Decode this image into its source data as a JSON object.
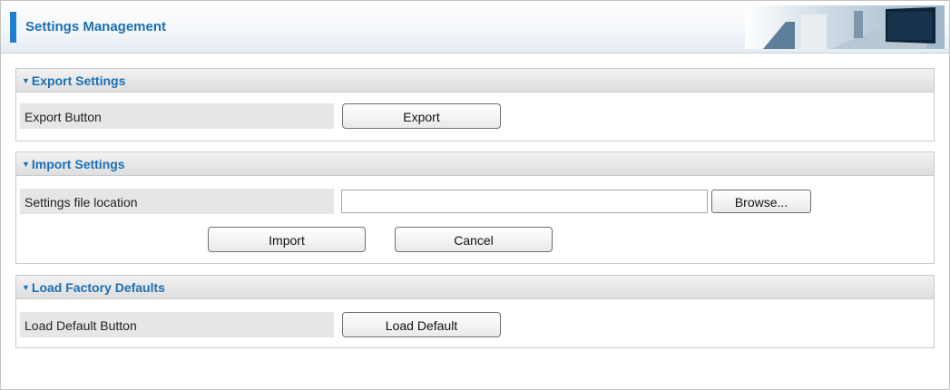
{
  "header": {
    "title": "Settings Management"
  },
  "export_section": {
    "title": "Export Settings",
    "row_label": "Export Button",
    "button_label": "Export"
  },
  "import_section": {
    "title": "Import Settings",
    "row_label": "Settings file location",
    "file_value": "",
    "browse_label": "Browse...",
    "import_label": "Import",
    "cancel_label": "Cancel"
  },
  "defaults_section": {
    "title": "Load Factory Defaults",
    "row_label": "Load Default Button",
    "button_label": "Load Default"
  },
  "colors": {
    "accent": "#1f7fd1",
    "title_text": "#1b6fb5"
  },
  "icons": {
    "section_toggle": "triangle-down-icon"
  }
}
